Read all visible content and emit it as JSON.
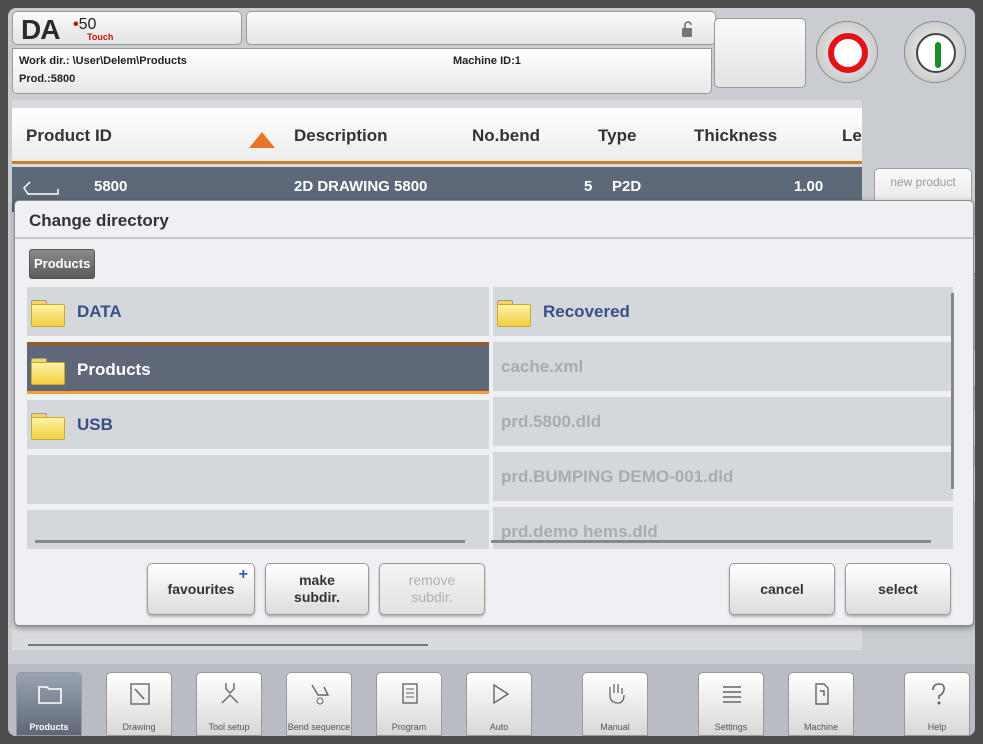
{
  "header": {
    "logo_text": "DA",
    "logo_model": "50",
    "logo_touch": "Touch",
    "work_dir": "Work dir.: \\User\\Delem\\Products",
    "product": "Prod.:5800",
    "machine_id": "Machine ID:1"
  },
  "table": {
    "columns": [
      "Product ID",
      "Description",
      "No.bend",
      "Type",
      "Thickness",
      "Le"
    ],
    "row": {
      "id": "5800",
      "description": "2D DRAWING 5800",
      "bends": "5",
      "type": "P2D",
      "thickness": "1.00"
    },
    "side_button": "new product"
  },
  "dialog": {
    "title": "Change directory",
    "breadcrumb": "Products",
    "folders": [
      "DATA",
      "Products",
      "USB"
    ],
    "right_items": [
      {
        "label": "Recovered",
        "kind": "folder"
      },
      {
        "label": "cache.xml",
        "kind": "file"
      },
      {
        "label": "prd.5800.dld",
        "kind": "file"
      },
      {
        "label": "prd.BUMPING DEMO-001.dld",
        "kind": "file"
      },
      {
        "label": "prd.demo hems.dld",
        "kind": "file"
      }
    ],
    "selected": "Products",
    "buttons": {
      "favourites": "favourites",
      "make_subdir_1": "make",
      "make_subdir_2": "subdir.",
      "remove_subdir_1": "remove",
      "remove_subdir_2": "subdir.",
      "cancel": "cancel",
      "select": "select"
    }
  },
  "tabs": [
    {
      "label": "Products",
      "active": true
    },
    {
      "label": "Drawing"
    },
    {
      "label": "Tool setup"
    },
    {
      "label": "Bend sequence"
    },
    {
      "label": "Program"
    },
    {
      "label": "Auto"
    },
    {
      "label": "Manual"
    },
    {
      "label": "Settings"
    },
    {
      "label": "Machine"
    },
    {
      "label": "Help"
    }
  ],
  "colors": {
    "stop": "#e2141a",
    "start": "#1e8c2c",
    "selection": "#5e6878",
    "accent": "#e8742a"
  }
}
